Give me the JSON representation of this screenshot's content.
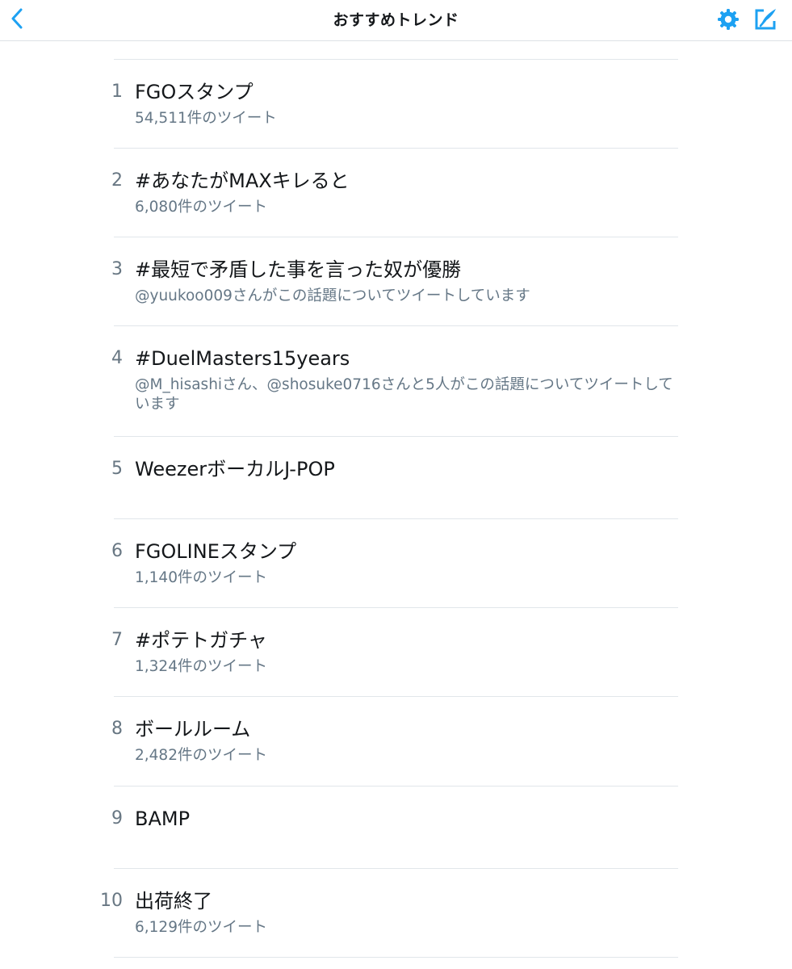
{
  "header": {
    "title": "おすすめトレンド",
    "back_icon": "chevron-left-icon",
    "settings_icon": "gear-icon",
    "compose_icon": "compose-icon",
    "accent_color": "#1da1f2"
  },
  "trends": [
    {
      "rank": "1",
      "name": "FGOスタンプ",
      "meta": "54,511件のツイート"
    },
    {
      "rank": "2",
      "name": "#あなたがMAXキレると",
      "meta": "6,080件のツイート"
    },
    {
      "rank": "3",
      "name": "#最短で矛盾した事を言った奴が優勝",
      "meta": "@yuukoo009さんがこの話題についてツイートしています"
    },
    {
      "rank": "4",
      "name": "#DuelMasters15years",
      "meta": "@M_hisashiさん、@shosuke0716さんと5人がこの話題についてツイートしています"
    },
    {
      "rank": "5",
      "name": "WeezerボーカルJ-POP",
      "meta": ""
    },
    {
      "rank": "6",
      "name": "FGOLINEスタンプ",
      "meta": "1,140件のツイート"
    },
    {
      "rank": "7",
      "name": "#ポテトガチャ",
      "meta": "1,324件のツイート"
    },
    {
      "rank": "8",
      "name": "ボールルーム",
      "meta": "2,482件のツイート"
    },
    {
      "rank": "9",
      "name": "BAMP",
      "meta": ""
    },
    {
      "rank": "10",
      "name": "出荷終了",
      "meta": "6,129件のツイート"
    }
  ]
}
